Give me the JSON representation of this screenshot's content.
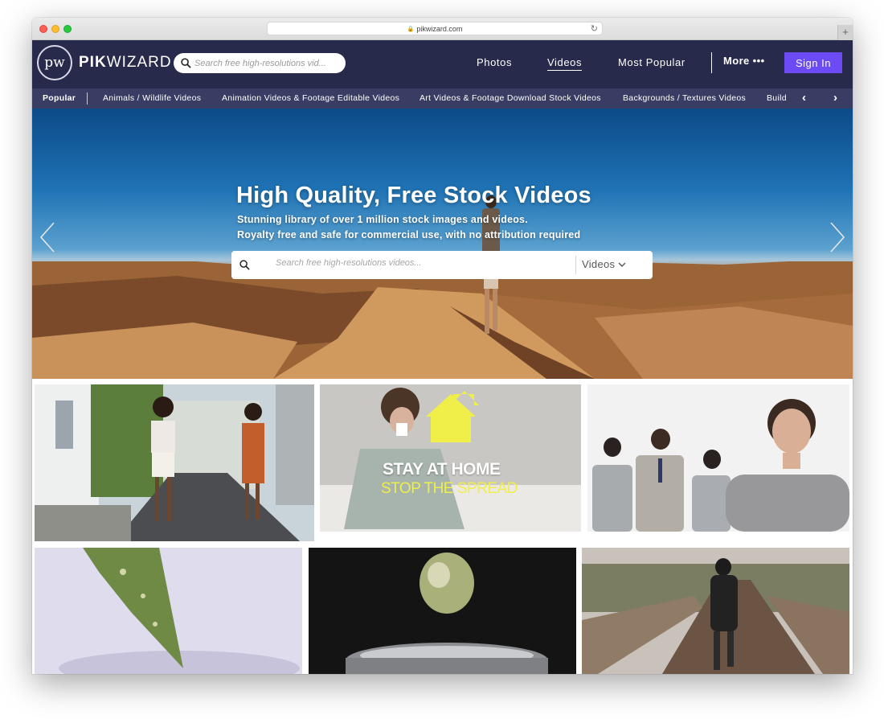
{
  "browser": {
    "url": "pikwizard.com"
  },
  "header": {
    "logo_mark": "pw",
    "logo_bold": "PIK",
    "logo_light": "WIZARD",
    "search_placeholder": "Search free high-resolutions vid...",
    "nav": [
      {
        "label": "Photos",
        "active": false
      },
      {
        "label": "Videos",
        "active": true
      },
      {
        "label": "Most Popular",
        "active": false
      }
    ],
    "more_label": "More •••",
    "signin_label": "Sign In"
  },
  "categories": {
    "popular_label": "Popular",
    "items": [
      "Animals / Wildlife Videos",
      "Animation Videos & Footage Editable Videos",
      "Art Videos & Footage Download Stock Videos",
      "Backgrounds / Textures Videos",
      "Build"
    ]
  },
  "hero": {
    "title": "High Quality, Free Stock Videos",
    "subtitle_1": "Stunning library of over 1 million stock images and videos.",
    "subtitle_2": "Royalty free and safe for commercial use, with no attribution required",
    "search_placeholder": "Search free high-resolutions videos...",
    "search_type": "Videos"
  },
  "tiles": {
    "stay_home_line1": "STAY AT HOME",
    "stay_home_line2": "STOP THE SPREAD"
  },
  "colors": {
    "header_bg": "#272a4b",
    "category_bg": "#393d63",
    "signin_bg": "#6c4bf5",
    "stay_home_yellow": "#f0ee48"
  }
}
